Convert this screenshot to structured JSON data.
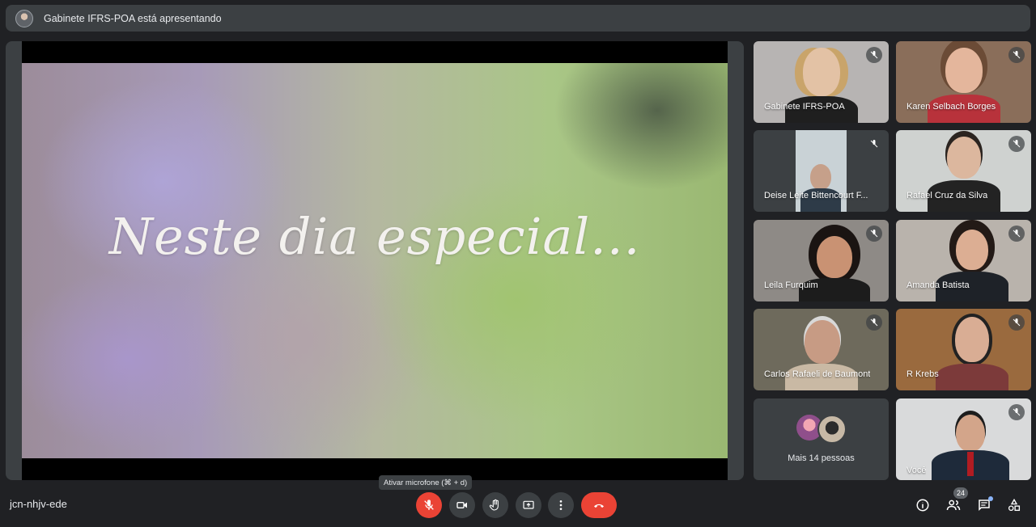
{
  "presenter": {
    "text": "Gabinete IFRS-POA está apresentando"
  },
  "slide": {
    "text": "Neste dia especial..."
  },
  "participants": [
    {
      "name": "Gabinete IFRS-POA",
      "muted": true
    },
    {
      "name": "Karen Selbach Borges",
      "muted": true
    },
    {
      "name": "Deise Leite Bittencourt F...",
      "muted": true
    },
    {
      "name": "Rafael Cruz da Silva",
      "muted": true
    },
    {
      "name": "Leila Furquim",
      "muted": true
    },
    {
      "name": "Amanda Batista",
      "muted": true
    },
    {
      "name": "Carlos Rafaeli de Baumont",
      "muted": true
    },
    {
      "name": "R Krebs",
      "muted": true
    },
    {
      "name": "Você",
      "muted": true
    }
  ],
  "more": {
    "label": "Mais 14 pessoas"
  },
  "meeting": {
    "code": "jcn-nhjv-ede"
  },
  "tooltip": {
    "mic": "Ativar microfone (⌘ + d)"
  },
  "people_count": "24",
  "colors": {
    "accent_red": "#ea4335",
    "bar_bg": "#3c4043",
    "page_bg": "#202124"
  }
}
